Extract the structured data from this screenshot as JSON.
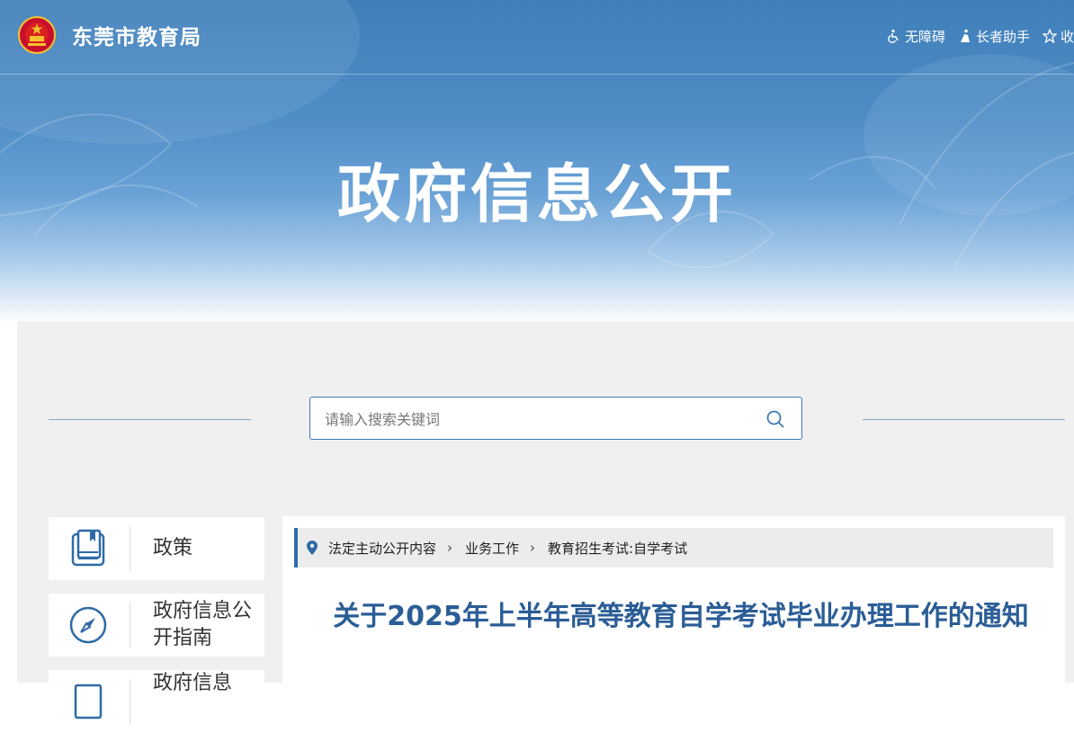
{
  "site": {
    "name": "东莞市教育局",
    "emblem_icon": "national-emblem-icon"
  },
  "toolbar": {
    "accessibility": {
      "label": "无障碍",
      "icon": "wheelchair-icon"
    },
    "elder_mode": {
      "label": "长者助手",
      "icon": "elder-icon"
    },
    "favorite": {
      "label": "收",
      "icon": "star-icon"
    }
  },
  "banner": {
    "title": "政府信息公开"
  },
  "search": {
    "placeholder": "请输入搜索关键词",
    "value": "",
    "icon": "search-icon"
  },
  "sidebar": {
    "items": [
      {
        "label": "政策",
        "icon": "policy-book-icon"
      },
      {
        "label": "政府信息公开指南",
        "icon": "compass-icon"
      },
      {
        "label": "政府信息",
        "icon": "document-icon"
      }
    ]
  },
  "breadcrumb": {
    "icon": "location-pin-icon",
    "items": [
      "法定主动公开内容",
      "业务工作",
      "教育招生考试:自学考试"
    ]
  },
  "article": {
    "title": "关于2025年上半年高等教育自学考试毕业办理工作的通知"
  },
  "colors": {
    "primary": "#2f6aa6",
    "title": "#2b5d96",
    "background": "#f0f0f0"
  }
}
